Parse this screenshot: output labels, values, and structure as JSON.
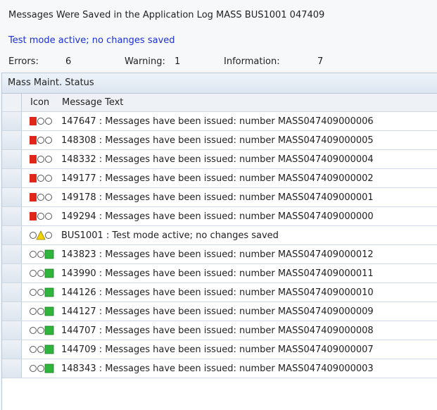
{
  "header": {
    "title": "Messages Were Saved in the Application Log MASS BUS1001 047409",
    "status_note": "Test mode active; no changes saved",
    "errors_label": "Errors:",
    "errors_value": "6",
    "warning_label": "Warning:",
    "warning_value": "1",
    "information_label": "Information:",
    "information_value": "7"
  },
  "panel": {
    "title": "Mass Maint. Status",
    "columns": {
      "icon": "Icon",
      "message": "Message Text"
    }
  },
  "colors": {
    "error": "#e0251b",
    "warning": "#f2d200",
    "success": "#2fb53b",
    "link_blue": "#1a2fd8"
  },
  "rows": [
    {
      "type": "error",
      "icon": "error-traffic-light-icon",
      "text": "147647 : Messages have been issued: number MASS047409000006"
    },
    {
      "type": "error",
      "icon": "error-traffic-light-icon",
      "text": "148308 : Messages have been issued: number MASS047409000005"
    },
    {
      "type": "error",
      "icon": "error-traffic-light-icon",
      "text": "148332 : Messages have been issued: number MASS047409000004"
    },
    {
      "type": "error",
      "icon": "error-traffic-light-icon",
      "text": "149177 : Messages have been issued: number MASS047409000002"
    },
    {
      "type": "error",
      "icon": "error-traffic-light-icon",
      "text": "149178 : Messages have been issued: number MASS047409000001"
    },
    {
      "type": "error",
      "icon": "error-traffic-light-icon",
      "text": "149294 : Messages have been issued: number MASS047409000000"
    },
    {
      "type": "warning",
      "icon": "warning-traffic-light-icon",
      "text": "BUS1001 : Test mode active; no changes saved"
    },
    {
      "type": "success",
      "icon": "success-traffic-light-icon",
      "text": "143823 : Messages have been issued: number MASS047409000012"
    },
    {
      "type": "success",
      "icon": "success-traffic-light-icon",
      "text": "143990 : Messages have been issued: number MASS047409000011"
    },
    {
      "type": "success",
      "icon": "success-traffic-light-icon",
      "text": "144126 : Messages have been issued: number MASS047409000010"
    },
    {
      "type": "success",
      "icon": "success-traffic-light-icon",
      "text": "144127 : Messages have been issued: number MASS047409000009"
    },
    {
      "type": "success",
      "icon": "success-traffic-light-icon",
      "text": "144707 : Messages have been issued: number MASS047409000008"
    },
    {
      "type": "success",
      "icon": "success-traffic-light-icon",
      "text": "144709 : Messages have been issued: number MASS047409000007"
    },
    {
      "type": "success",
      "icon": "success-traffic-light-icon",
      "text": "148343 : Messages have been issued: number MASS047409000003"
    }
  ]
}
